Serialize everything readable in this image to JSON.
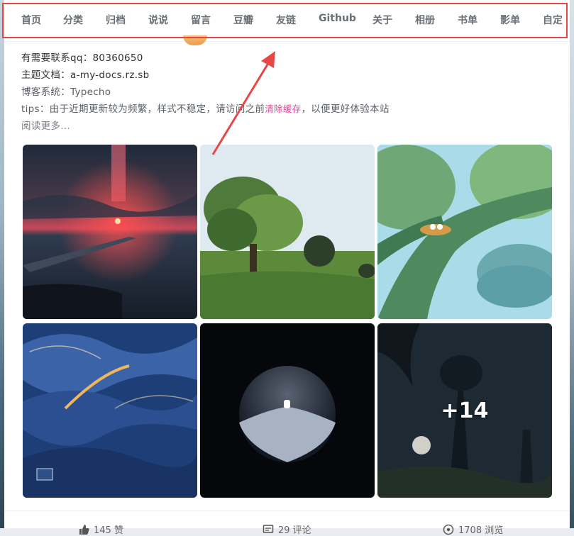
{
  "nav": {
    "items": [
      "首页",
      "分类",
      "归档",
      "说说",
      "留言",
      "豆瓣",
      "友链",
      "Github",
      "关于",
      "相册",
      "书单",
      "影单",
      "自定"
    ]
  },
  "post": {
    "line1_label": "有需要联系qq：",
    "line1_value": "80360650",
    "line2_label": "主题文档：",
    "line2_value": "a-my-docs.rz.sb",
    "line3_label": "博客系统：",
    "line3_value": "Typecho",
    "tips_before": "tips：由于近期更新较为频繁，样式不稳定，请访问之前",
    "tips_link": "清除缓存",
    "tips_after": "，以便更好体验本站",
    "read_more": "阅读更多..."
  },
  "gallery": {
    "more_count": "+14"
  },
  "stats": {
    "likes": "145 赞",
    "comments": "29 评论",
    "views": "1708 浏览"
  },
  "colors": {
    "highlight": "#e64747",
    "link": "#e0439a"
  }
}
